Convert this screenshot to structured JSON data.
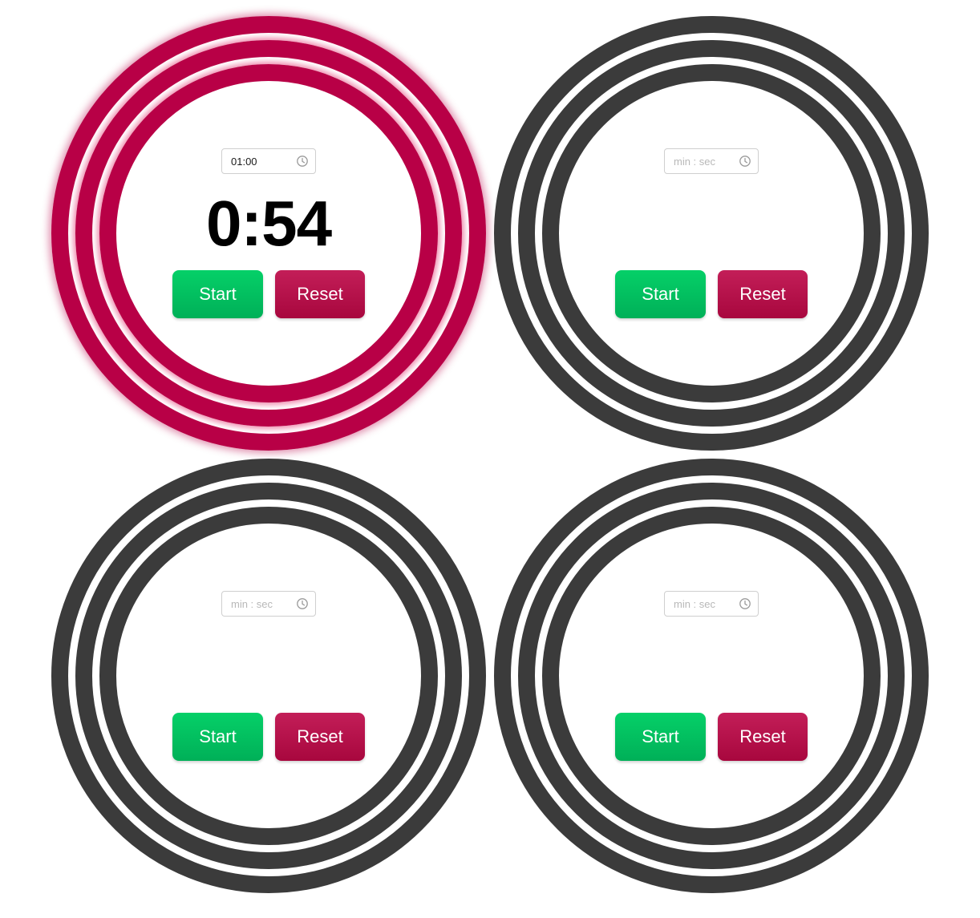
{
  "timers": [
    {
      "input_value": "01:00",
      "input_placeholder": "min : sec",
      "display": "0:54",
      "start_label": "Start",
      "reset_label": "Reset",
      "active": true
    },
    {
      "input_value": "",
      "input_placeholder": "min : sec",
      "display": "",
      "start_label": "Start",
      "reset_label": "Reset",
      "active": false
    },
    {
      "input_value": "",
      "input_placeholder": "min : sec",
      "display": "",
      "start_label": "Start",
      "reset_label": "Reset",
      "active": false
    },
    {
      "input_value": "",
      "input_placeholder": "min : sec",
      "display": "",
      "start_label": "Start",
      "reset_label": "Reset",
      "active": false
    }
  ],
  "icons": {
    "input": "clock-icon"
  },
  "colors": {
    "ring_idle": "#3b3b3b",
    "ring_active": "#b80046",
    "ring_active_glow": "#ec78a0",
    "start_button": "#00c060",
    "reset_button": "#b8124c"
  }
}
